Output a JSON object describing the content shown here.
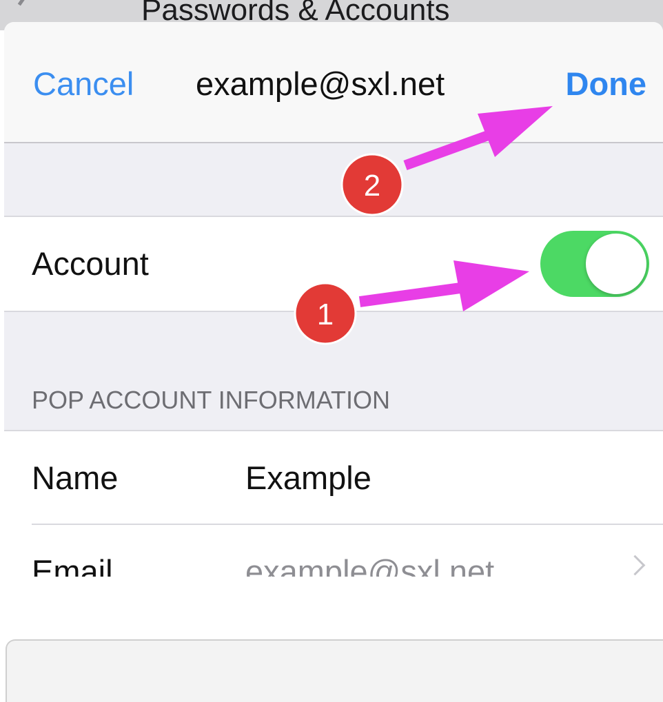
{
  "background": {
    "title": "Passwords & Accounts"
  },
  "navbar": {
    "cancel_label": "Cancel",
    "title": "example@sxl.net",
    "done_label": "Done"
  },
  "account": {
    "label": "Account",
    "toggle_on": true
  },
  "pop_section": {
    "header": "POP ACCOUNT INFORMATION",
    "rows": [
      {
        "label": "Name",
        "value": "Example"
      },
      {
        "label": "Email",
        "value": "example@sxl.net"
      }
    ]
  },
  "annotations": [
    {
      "number": "1",
      "target": "account-toggle"
    },
    {
      "number": "2",
      "target": "done-button"
    }
  ],
  "colors": {
    "accent_blue": "#2f86ef",
    "toggle_green": "#4cd964",
    "arrow_magenta": "#e83ee6",
    "badge_red": "#e23a36"
  },
  "icons": {
    "chevron": "chevron-right-icon",
    "back": "back-chevron-icon"
  }
}
